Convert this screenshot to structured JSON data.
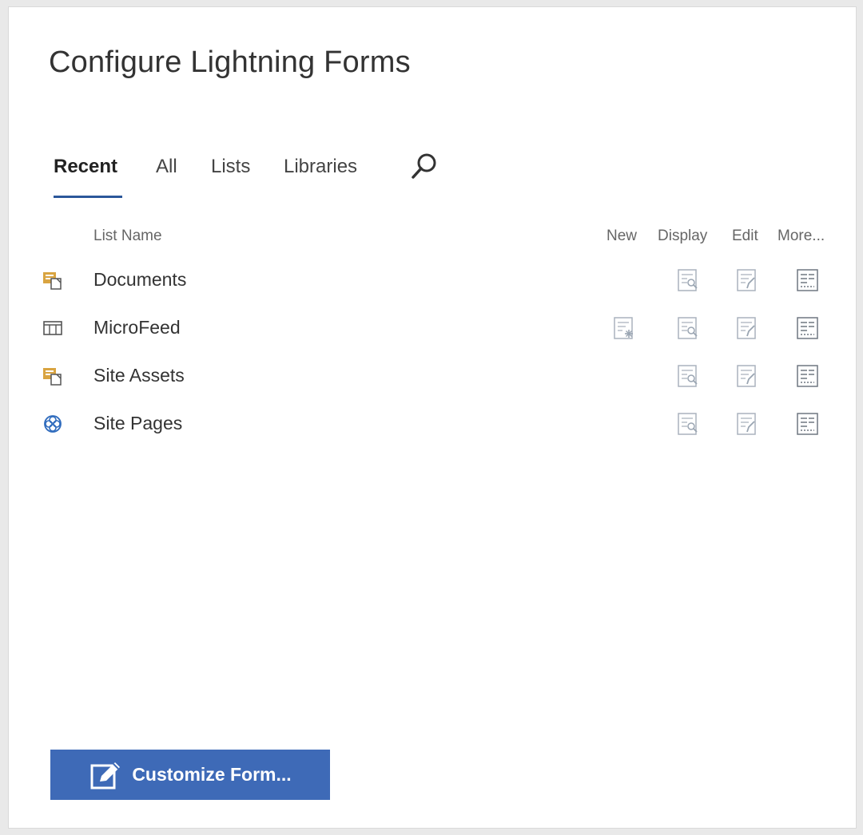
{
  "page": {
    "title": "Configure Lightning Forms"
  },
  "tabs": [
    {
      "label": "Recent",
      "active": true
    },
    {
      "label": "All",
      "active": false
    },
    {
      "label": "Lists",
      "active": false
    },
    {
      "label": "Libraries",
      "active": false
    }
  ],
  "search": {
    "icon": "search-icon"
  },
  "columns": {
    "list_name": "List Name",
    "new": "New",
    "display": "Display",
    "edit": "Edit",
    "more": "More..."
  },
  "lists": [
    {
      "name": "Documents",
      "icon": "document-library-icon",
      "has_new": false
    },
    {
      "name": "MicroFeed",
      "icon": "list-table-icon",
      "has_new": true
    },
    {
      "name": "Site Assets",
      "icon": "document-library-icon",
      "has_new": false
    },
    {
      "name": "Site Pages",
      "icon": "site-pages-icon",
      "has_new": false
    }
  ],
  "actions": {
    "new_icon": "new-form-icon",
    "display_icon": "display-form-icon",
    "edit_icon": "edit-form-icon",
    "more_icon": "more-forms-icon"
  },
  "customize_button": {
    "label": "Customize Form...",
    "icon": "edit-form-icon"
  },
  "colors": {
    "accent": "#2b579a",
    "button_bg": "#3e6ab7",
    "library_icon": "#d9a441",
    "site_pages_icon": "#2f6bbd"
  }
}
